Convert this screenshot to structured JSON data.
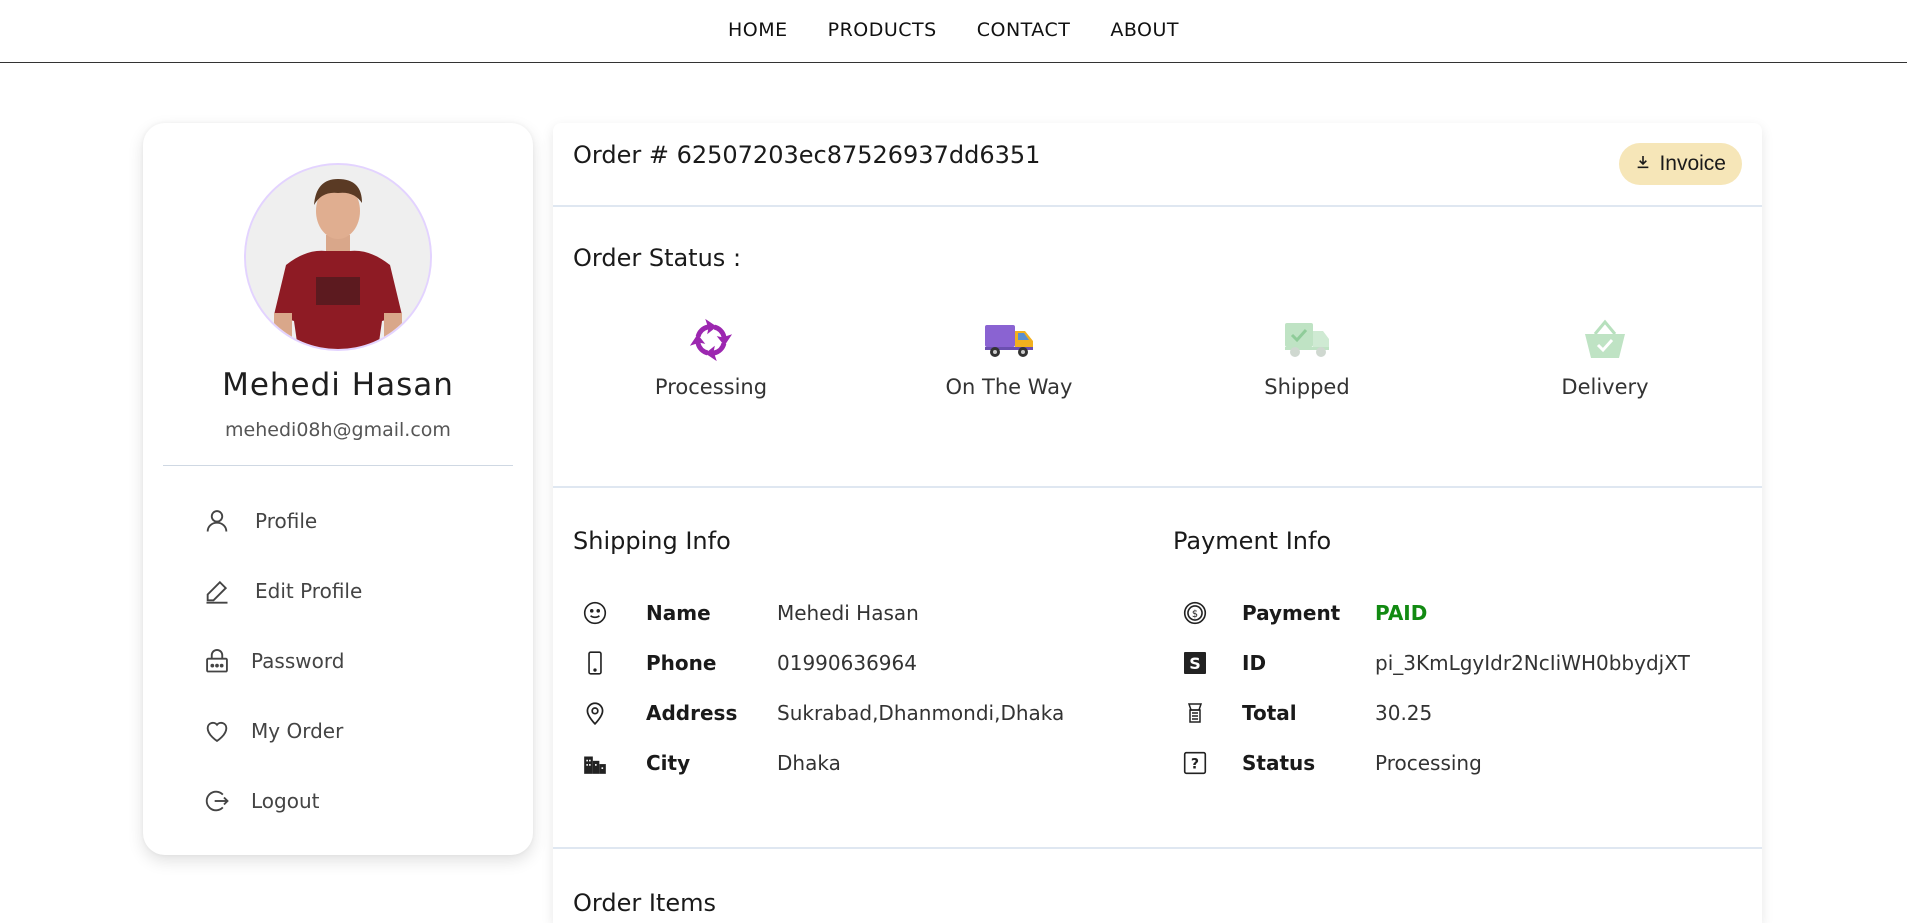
{
  "nav": {
    "links": [
      "HOME",
      "PRODUCTS",
      "CONTACT",
      "ABOUT"
    ]
  },
  "profile": {
    "name": "Mehedi Hasan",
    "email": "mehedi08h@gmail.com",
    "menu": [
      {
        "label": "Profile",
        "icon": "user-icon"
      },
      {
        "label": "Edit Profile",
        "icon": "pencil-icon"
      },
      {
        "label": "Password",
        "icon": "lock-icon"
      },
      {
        "label": "My Order",
        "icon": "heart-icon"
      },
      {
        "label": "Logout",
        "icon": "logout-icon"
      }
    ]
  },
  "order": {
    "title": "Order # 62507203ec87526937dd6351",
    "invoice_label": "Invoice",
    "status_heading": "Order Status :",
    "steps": [
      {
        "label": "Processing",
        "icon": "processing-arrows-icon",
        "active": true
      },
      {
        "label": "On The Way",
        "icon": "truck-icon",
        "active": true
      },
      {
        "label": "Shipped",
        "icon": "shipped-truck-icon",
        "active": false
      },
      {
        "label": "Delivery",
        "icon": "basket-check-icon",
        "active": false
      }
    ],
    "shipping": {
      "title": "Shipping Info",
      "rows": [
        {
          "key": "Name",
          "value": "Mehedi Hasan",
          "icon": "smiley-icon"
        },
        {
          "key": "Phone",
          "value": "01990636964",
          "icon": "phone-icon"
        },
        {
          "key": "Address",
          "value": "Sukrabad,Dhanmondi,Dhaka",
          "icon": "location-pin-icon"
        },
        {
          "key": "City",
          "value": "Dhaka",
          "icon": "city-icon"
        }
      ]
    },
    "payment": {
      "title": "Payment Info",
      "rows": [
        {
          "key": "Payment",
          "value": "PAID",
          "icon": "dollar-circle-icon"
        },
        {
          "key": "ID",
          "value": "pi_3KmLgyIdr2NcIiWH0bbydjXT",
          "icon": "stripe-icon"
        },
        {
          "key": "Total",
          "value": "30.25",
          "icon": "money-icon"
        },
        {
          "key": "Status",
          "value": "Processing",
          "icon": "question-box-icon"
        }
      ]
    },
    "items_title": "Order Items"
  },
  "colors": {
    "invoice_bg": "#f6e6b8",
    "paid": "#128a12",
    "processing": "#9c27b0",
    "avatar_border": "#e3d3ff"
  }
}
